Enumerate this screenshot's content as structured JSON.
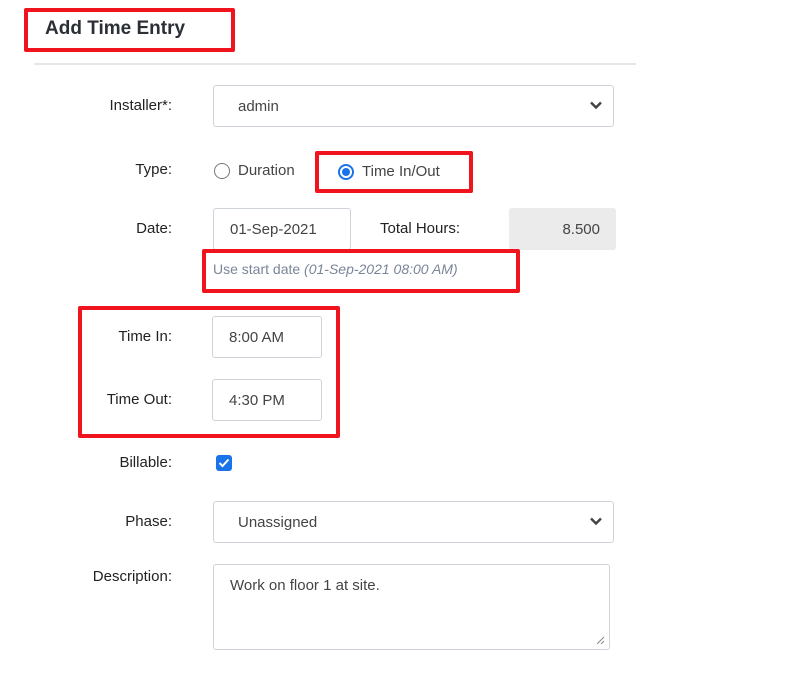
{
  "form": {
    "title": "Add Time Entry",
    "installer": {
      "label": "Installer*:",
      "value": "admin"
    },
    "type": {
      "label": "Type:",
      "options": [
        {
          "label": "Duration",
          "checked": false
        },
        {
          "label": "Time In/Out",
          "checked": true
        }
      ]
    },
    "date": {
      "label": "Date:",
      "value": "01-Sep-2021"
    },
    "total_hours": {
      "label": "Total Hours:",
      "value": "8.500"
    },
    "use_start_date": {
      "text": "Use start date",
      "value": "(01-Sep-2021 08:00 AM)"
    },
    "time_in": {
      "label": "Time In:",
      "value": "8:00 AM"
    },
    "time_out": {
      "label": "Time Out:",
      "value": "4:30 PM"
    },
    "billable": {
      "label": "Billable:",
      "checked": true
    },
    "phase": {
      "label": "Phase:",
      "value": "Unassigned"
    },
    "description": {
      "label": "Description:",
      "value": "Work on floor 1 at site."
    }
  },
  "colors": {
    "highlight": "#f0141e",
    "accent": "#1a73e8"
  }
}
